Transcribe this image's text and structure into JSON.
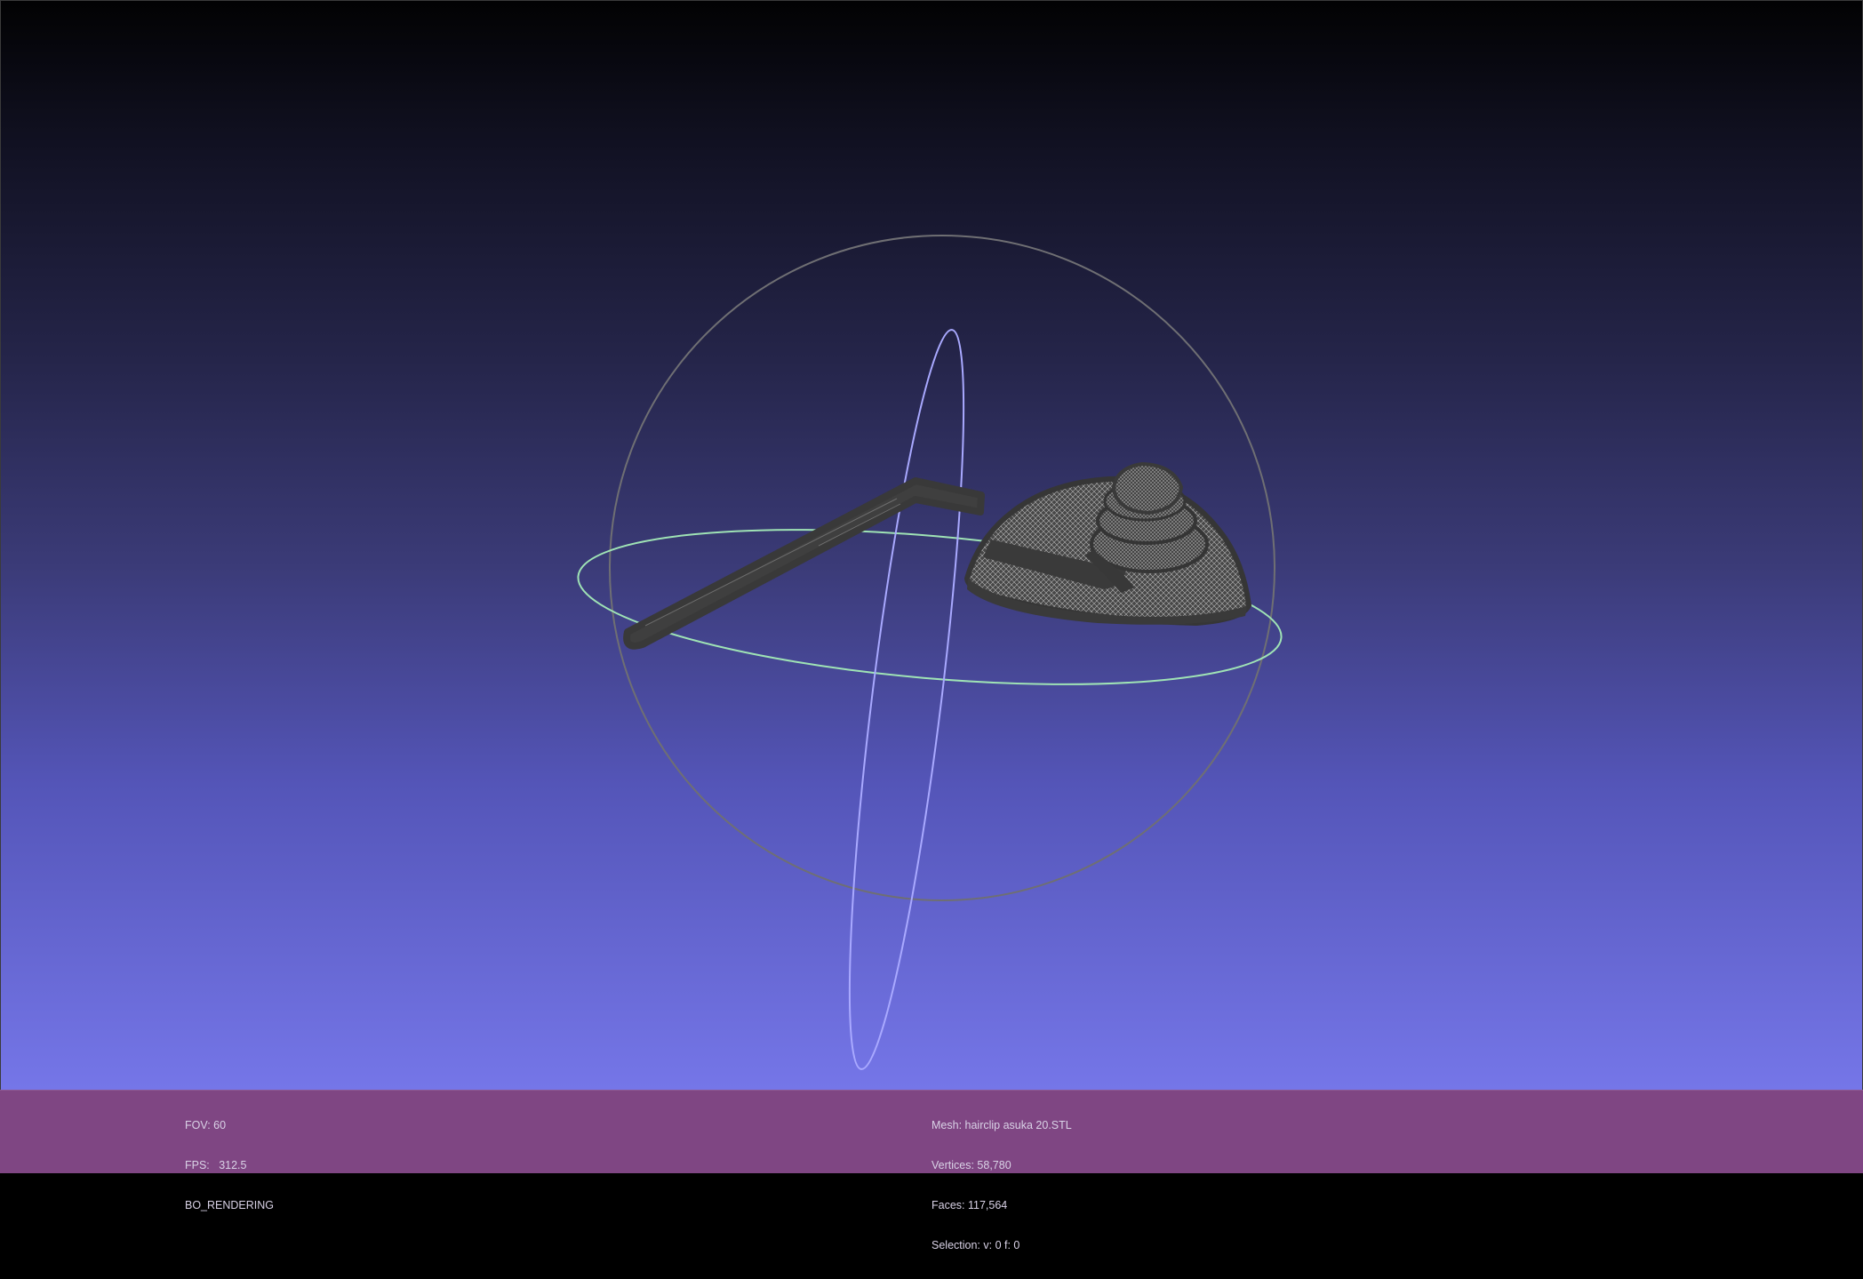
{
  "viewer": {
    "fov": "FOV: 60",
    "fps": "FPS:   312.5",
    "rendering": "BO_RENDERING"
  },
  "mesh": {
    "name": "Mesh: hairclip asuka 20.STL",
    "vertices": "Vertices: 58,780",
    "faces": "Faces: 117,564",
    "selection": "Selection: v: 0 f: 0"
  },
  "icons": {
    "trackball": "trackball-icon",
    "model": "hairclip-mesh"
  },
  "colors": {
    "info_bar": "#7f4683",
    "trackball_sphere": "#6f6f73",
    "trackball_vertical_ring": "#a9a9ff",
    "trackball_horizontal_ring": "#9fe3b5",
    "mesh": "#3d3d3d"
  }
}
